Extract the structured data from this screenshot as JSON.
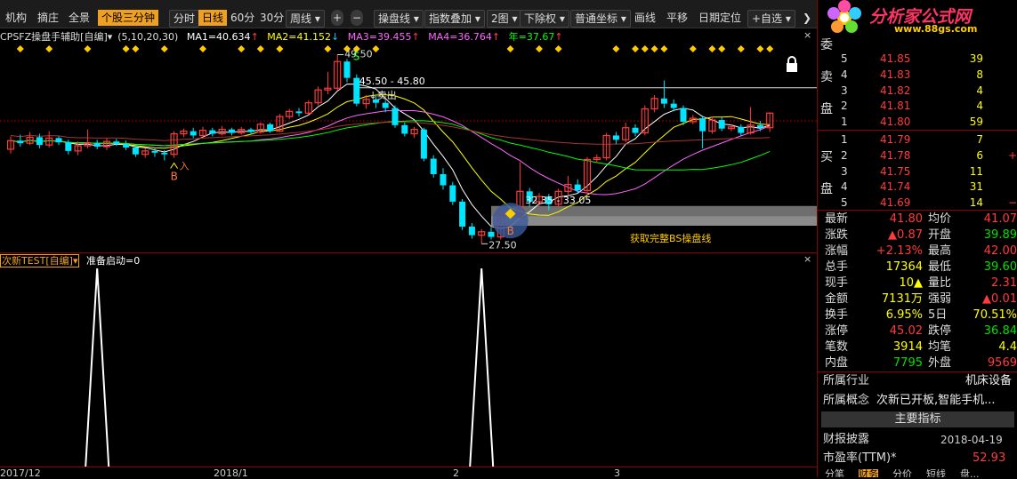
{
  "toolbar": {
    "items": [
      "机构",
      "摘庄",
      "全景",
      "个股三分钟",
      "分时",
      "日线",
      "60分",
      "30分",
      "周线 ▾",
      "+",
      "−",
      "操盘线 ▾",
      "指数叠加 ▾",
      "2图 ▾",
      "下除权 ▾",
      "普通坐标 ▾",
      "画线",
      "平移",
      "日期定位",
      "+自选 ▾",
      "❯"
    ]
  },
  "indicator": {
    "name": "CPSFZ操盘手辅助[自编]▾",
    "params": "(5,10,20,30)",
    "ma1": "MA1=40.634",
    "ma2": "MA2=41.152",
    "ma3": "MA3=39.455",
    "ma4": "MA4=36.764",
    "year": "年=37.67",
    "arrow_up": "↑",
    "arrow_down": "↓",
    "colors": {
      "ma1": "#ffffff",
      "ma2": "#ffff00",
      "ma3": "#ff66ff",
      "ma4": "#00ff00",
      "year": "#ffff00"
    }
  },
  "chart_data": {
    "type": "candlestick",
    "high_label": "49.50",
    "low_label": "27.50",
    "range_label": "45.50 - 45.80",
    "sell_label": "↓卖出",
    "buy_label": "入",
    "b_label": "B",
    "s_label": "S",
    "bs_text": "获取完整BS操盘线",
    "mid_label": "32.35 - 33.05",
    "x_ticks": [
      "2017/12",
      "2018/1",
      "2",
      "3"
    ],
    "candles": [
      {
        "o": 38.5,
        "c": 39.5,
        "h": 40.0,
        "l": 38.0
      },
      {
        "o": 39.5,
        "c": 39.2,
        "h": 40.2,
        "l": 38.8
      },
      {
        "o": 39.2,
        "c": 39.9,
        "h": 40.5,
        "l": 39.0
      },
      {
        "o": 39.9,
        "c": 39.0,
        "h": 40.3,
        "l": 38.6
      },
      {
        "o": 39.0,
        "c": 39.8,
        "h": 40.6,
        "l": 38.7
      },
      {
        "o": 39.8,
        "c": 39.3,
        "h": 40.0,
        "l": 39.0
      },
      {
        "o": 39.3,
        "c": 38.3,
        "h": 39.6,
        "l": 37.9
      },
      {
        "o": 38.3,
        "c": 38.9,
        "h": 39.4,
        "l": 37.8
      },
      {
        "o": 38.9,
        "c": 39.2,
        "h": 40.8,
        "l": 38.6
      },
      {
        "o": 39.2,
        "c": 38.8,
        "h": 39.6,
        "l": 38.5
      },
      {
        "o": 38.8,
        "c": 39.4,
        "h": 39.8,
        "l": 38.4
      },
      {
        "o": 39.4,
        "c": 39.1,
        "h": 39.7,
        "l": 38.9
      },
      {
        "o": 39.1,
        "c": 38.7,
        "h": 39.5,
        "l": 38.4
      },
      {
        "o": 38.7,
        "c": 37.9,
        "h": 39.0,
        "l": 37.6
      },
      {
        "o": 37.9,
        "c": 38.3,
        "h": 38.6,
        "l": 37.5
      },
      {
        "o": 38.3,
        "c": 38.1,
        "h": 38.6,
        "l": 37.6
      },
      {
        "o": 38.1,
        "c": 37.9,
        "h": 38.4,
        "l": 37.2
      },
      {
        "o": 37.9,
        "c": 40.3,
        "h": 40.6,
        "l": 37.5
      },
      {
        "o": 40.3,
        "c": 40.6,
        "h": 40.9,
        "l": 39.9
      },
      {
        "o": 40.6,
        "c": 40.1,
        "h": 41.0,
        "l": 39.8
      },
      {
        "o": 40.1,
        "c": 40.7,
        "h": 41.1,
        "l": 39.9
      },
      {
        "o": 40.7,
        "c": 40.3,
        "h": 41.0,
        "l": 40.0
      },
      {
        "o": 40.3,
        "c": 40.8,
        "h": 41.2,
        "l": 40.1
      },
      {
        "o": 40.8,
        "c": 40.4,
        "h": 41.0,
        "l": 40.1
      },
      {
        "o": 40.4,
        "c": 40.8,
        "h": 41.1,
        "l": 40.2
      },
      {
        "o": 40.8,
        "c": 40.5,
        "h": 41.0,
        "l": 40.2
      },
      {
        "o": 40.5,
        "c": 41.4,
        "h": 41.6,
        "l": 40.3
      },
      {
        "o": 41.4,
        "c": 40.6,
        "h": 41.6,
        "l": 40.4
      },
      {
        "o": 40.6,
        "c": 42.3,
        "h": 42.6,
        "l": 40.5
      },
      {
        "o": 42.3,
        "c": 42.9,
        "h": 43.2,
        "l": 42.0
      },
      {
        "o": 42.9,
        "c": 42.7,
        "h": 43.3,
        "l": 42.3
      },
      {
        "o": 42.7,
        "c": 43.9,
        "h": 44.2,
        "l": 42.5
      },
      {
        "o": 43.9,
        "c": 45.4,
        "h": 45.8,
        "l": 43.6
      },
      {
        "o": 45.4,
        "c": 45.6,
        "h": 47.5,
        "l": 44.9
      },
      {
        "o": 45.6,
        "c": 48.7,
        "h": 49.5,
        "l": 45.3
      },
      {
        "o": 48.7,
        "c": 46.8,
        "h": 49.0,
        "l": 46.3
      },
      {
        "o": 46.8,
        "c": 43.8,
        "h": 47.2,
        "l": 43.5
      },
      {
        "o": 43.8,
        "c": 44.3,
        "h": 44.8,
        "l": 43.2
      },
      {
        "o": 44.3,
        "c": 43.9,
        "h": 44.7,
        "l": 43.3
      },
      {
        "o": 43.9,
        "c": 43.3,
        "h": 44.2,
        "l": 42.8
      },
      {
        "o": 43.3,
        "c": 41.3,
        "h": 43.6,
        "l": 41.0
      },
      {
        "o": 41.3,
        "c": 40.3,
        "h": 41.6,
        "l": 40.0
      },
      {
        "o": 40.3,
        "c": 40.8,
        "h": 41.1,
        "l": 39.8
      },
      {
        "o": 40.8,
        "c": 37.4,
        "h": 41.0,
        "l": 37.1
      },
      {
        "o": 37.4,
        "c": 35.6,
        "h": 37.8,
        "l": 35.2
      },
      {
        "o": 35.6,
        "c": 34.3,
        "h": 36.3,
        "l": 33.8
      },
      {
        "o": 34.3,
        "c": 32.4,
        "h": 34.7,
        "l": 32.0
      },
      {
        "o": 32.4,
        "c": 29.5,
        "h": 32.7,
        "l": 29.1
      },
      {
        "o": 29.5,
        "c": 28.5,
        "h": 29.9,
        "l": 28.1
      },
      {
        "o": 28.5,
        "c": 28.9,
        "h": 29.2,
        "l": 27.5
      },
      {
        "o": 28.9,
        "c": 28.3,
        "h": 29.4,
        "l": 28.0
      },
      {
        "o": 28.3,
        "c": 31.2,
        "h": 31.6,
        "l": 28.0
      },
      {
        "o": 31.2,
        "c": 30.6,
        "h": 31.5,
        "l": 30.0
      },
      {
        "o": 30.6,
        "c": 33.6,
        "h": 37.0,
        "l": 30.5
      },
      {
        "o": 33.6,
        "c": 32.4,
        "h": 34.0,
        "l": 31.8
      },
      {
        "o": 32.4,
        "c": 33.0,
        "h": 33.4,
        "l": 31.9
      },
      {
        "o": 33.0,
        "c": 32.1,
        "h": 33.3,
        "l": 31.4
      },
      {
        "o": 32.1,
        "c": 33.6,
        "h": 33.9,
        "l": 31.8
      },
      {
        "o": 33.6,
        "c": 34.4,
        "h": 35.4,
        "l": 33.2
      },
      {
        "o": 34.4,
        "c": 33.7,
        "h": 35.0,
        "l": 33.4
      },
      {
        "o": 33.7,
        "c": 37.3,
        "h": 37.6,
        "l": 33.4
      },
      {
        "o": 37.3,
        "c": 37.5,
        "h": 37.9,
        "l": 36.9
      },
      {
        "o": 37.5,
        "c": 40.1,
        "h": 40.4,
        "l": 37.2
      },
      {
        "o": 40.1,
        "c": 39.6,
        "h": 40.5,
        "l": 39.1
      },
      {
        "o": 39.6,
        "c": 41.0,
        "h": 41.6,
        "l": 39.3
      },
      {
        "o": 41.0,
        "c": 40.4,
        "h": 41.4,
        "l": 40.0
      },
      {
        "o": 40.4,
        "c": 43.2,
        "h": 43.6,
        "l": 40.1
      },
      {
        "o": 43.2,
        "c": 44.4,
        "h": 44.8,
        "l": 42.8
      },
      {
        "o": 44.4,
        "c": 43.8,
        "h": 46.5,
        "l": 43.3
      },
      {
        "o": 43.8,
        "c": 43.3,
        "h": 44.3,
        "l": 42.9
      },
      {
        "o": 43.3,
        "c": 41.7,
        "h": 43.6,
        "l": 41.3
      },
      {
        "o": 41.7,
        "c": 42.1,
        "h": 42.5,
        "l": 41.4
      },
      {
        "o": 42.1,
        "c": 40.6,
        "h": 42.4,
        "l": 38.6
      },
      {
        "o": 40.6,
        "c": 41.9,
        "h": 42.3,
        "l": 40.3
      },
      {
        "o": 41.9,
        "c": 40.9,
        "h": 42.2,
        "l": 40.6
      },
      {
        "o": 40.9,
        "c": 41.1,
        "h": 41.4,
        "l": 40.6
      },
      {
        "o": 41.1,
        "c": 40.4,
        "h": 41.4,
        "l": 40.0
      },
      {
        "o": 40.4,
        "c": 41.3,
        "h": 43.4,
        "l": 40.2
      },
      {
        "o": 41.3,
        "c": 41.0,
        "h": 41.8,
        "l": 40.6
      },
      {
        "o": 41.0,
        "c": 42.7,
        "h": 42.8,
        "l": 40.5
      }
    ],
    "y_range": [
      26.5,
      51.0
    ],
    "sub_indicator": {
      "name": "次新TEST[自编]▾",
      "value_label": "准备启动=0",
      "spikes_at": [
        9,
        49
      ],
      "range": [
        0,
        1
      ]
    }
  },
  "right_panel": {
    "logo_text": "分析家公式网",
    "logo_url": "www.88gs.com",
    "side_labels": {
      "wei": "委",
      "sell1": "卖",
      "sell2": "盘",
      "buy1": "买",
      "buy2": "盘"
    },
    "asks": [
      {
        "level": "5",
        "price": "41.85",
        "vol": "39",
        "vol_color": "yellow"
      },
      {
        "level": "4",
        "price": "41.83",
        "vol": "8",
        "vol_color": "yellow"
      },
      {
        "level": "3",
        "price": "41.82",
        "vol": "4",
        "vol_color": "yellow"
      },
      {
        "level": "2",
        "price": "41.81",
        "vol": "4",
        "vol_color": "yellow"
      },
      {
        "level": "1",
        "price": "41.80",
        "vol": "59",
        "vol_color": "yellow"
      }
    ],
    "ask_extra": "−",
    "bids": [
      {
        "level": "1",
        "price": "41.79",
        "vol": "7",
        "vol_color": "yellow",
        "extra": ""
      },
      {
        "level": "2",
        "price": "41.78",
        "vol": "6",
        "vol_color": "yellow",
        "extra": "+"
      },
      {
        "level": "3",
        "price": "41.75",
        "vol": "11",
        "vol_color": "yellow",
        "extra": ""
      },
      {
        "level": "4",
        "price": "41.74",
        "vol": "31",
        "vol_color": "yellow",
        "extra": ""
      },
      {
        "level": "5",
        "price": "41.69",
        "vol": "14",
        "vol_color": "yellow",
        "extra": "−1"
      }
    ],
    "stats": [
      {
        "l1": "最新",
        "v1": "41.80",
        "c1": "red",
        "l2": "均价",
        "v2": "41.07",
        "c2": "red"
      },
      {
        "l1": "涨跌",
        "v1": "▲0.87",
        "c1": "red",
        "l2": "开盘",
        "v2": "39.89",
        "c2": "green"
      },
      {
        "l1": "涨幅",
        "v1": "+2.13%",
        "c1": "red",
        "l2": "最高",
        "v2": "42.00",
        "c2": "red"
      },
      {
        "l1": "总手",
        "v1": "17364",
        "c1": "yellow",
        "l2": "最低",
        "v2": "39.60",
        "c2": "green"
      },
      {
        "l1": "现手",
        "v1": "10▲",
        "c1": "yellow",
        "l2": "量比",
        "v2": "2.31",
        "c2": "red"
      },
      {
        "l1": "金额",
        "v1": "7131万",
        "c1": "yellow",
        "l2": "强弱",
        "v2": "▲0.01",
        "c2": "red"
      },
      {
        "l1": "换手",
        "v1": "6.95%",
        "c1": "yellow",
        "l2": "5日",
        "v2": "70.51%",
        "c2": "yellow"
      },
      {
        "l1": "涨停",
        "v1": "45.02",
        "c1": "red",
        "l2": "跌停",
        "v2": "36.84",
        "c2": "green"
      },
      {
        "l1": "笔数",
        "v1": "3914",
        "c1": "yellow",
        "l2": "均笔",
        "v2": "4.4",
        "c2": "yellow"
      },
      {
        "l1": "内盘",
        "v1": "7795",
        "c1": "green",
        "l2": "外盘",
        "v2": "9569",
        "c2": "red"
      }
    ],
    "industry_label": "所属行业",
    "industry_value": "机床设备",
    "concept_label": "所属概念",
    "concept_value": "次新已开板,智能手机...",
    "main_indicators": "主要指标",
    "disclose_label": "财报披露",
    "disclose_value": "2018-04-19",
    "pe_label": "市盈率(TTM)*",
    "pe_value": "52.93",
    "bottom_tabs": [
      "分笔",
      "财务",
      "分价",
      "短线",
      "盘..."
    ]
  }
}
